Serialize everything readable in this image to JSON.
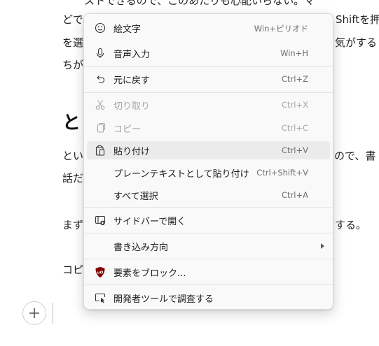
{
  "document": {
    "line1": "ストできるので、このあたりも心配いらない。マ",
    "line2a": "どで",
    "line2b": "Shiftを押",
    "line3a": "を選",
    "line3b": "気がする",
    "line4": "ちが",
    "heading": "と",
    "line5a": "とい",
    "line5b": "ので、書",
    "line6": "話だ",
    "line7a": "まず",
    "line7b": "する。",
    "line8": "コピ"
  },
  "menu": {
    "items": [
      {
        "icon": "emoji-icon",
        "label": "絵文字",
        "shortcut": "Win+ピリオド"
      },
      {
        "icon": "microphone-icon",
        "label": "音声入力",
        "shortcut": "Win+H"
      },
      {
        "icon": "undo-icon",
        "label": "元に戻す",
        "shortcut": "Ctrl+Z"
      },
      {
        "icon": "cut-icon",
        "label": "切り取り",
        "shortcut": "Ctrl+X",
        "disabled": true
      },
      {
        "icon": "copy-icon",
        "label": "コピー",
        "shortcut": "Ctrl+C",
        "disabled": true
      },
      {
        "icon": "paste-icon",
        "label": "貼り付け",
        "shortcut": "Ctrl+V",
        "hover": true
      },
      {
        "label": "プレーンテキストとして貼り付け",
        "shortcut": "Ctrl+Shift+V"
      },
      {
        "label": "すべて選択",
        "shortcut": "Ctrl+A"
      },
      {
        "icon": "sidebar-open-icon",
        "label": "サイドバーで開く"
      },
      {
        "label": "書き込み方向",
        "submenu": true
      },
      {
        "icon": "ublock-shield-icon",
        "label": "要素をブロック..."
      },
      {
        "icon": "devtools-inspect-icon",
        "label": "開発者ツールで調査する"
      }
    ]
  },
  "colors": {
    "menu_bg": "#f9f9f9",
    "hover_bg": "#ebebeb",
    "disabled_text": "#a6a6a6",
    "shortcut_text": "#6e6e6e",
    "ublock_red": "#800000"
  }
}
